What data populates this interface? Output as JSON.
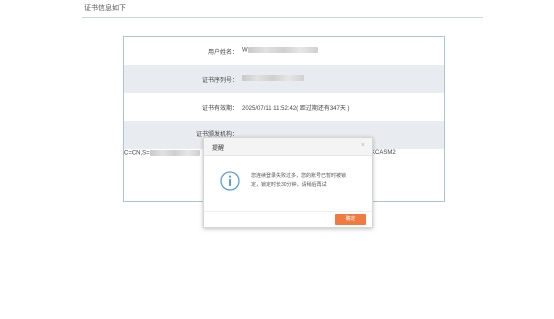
{
  "page": {
    "title": "证书信息如下"
  },
  "cert": {
    "rows": [
      {
        "label": "用户姓名：",
        "value_prefix": "W"
      },
      {
        "label": "证书序列号：",
        "value_prefix": ""
      },
      {
        "label": "证书有效期：",
        "value": "2025/07/11 11:52:42( 距过期还有347天 )"
      },
      {
        "label": "证书颁发机构："
      }
    ],
    "issuer_prefix": "C=CN,S=",
    "issuer_suffix": "KCASM2"
  },
  "dialog": {
    "title": "提醒",
    "close_symbol": "×",
    "message": "您连续登录失败过多，您的账号已暂时被锁定，锁定时长30分钟，请稍后再试",
    "ok_label": "确定",
    "icon": "info-circle-icon"
  },
  "colors": {
    "accent": "#f07a40",
    "icon": "#5aa0d8",
    "panel_border": "#a9c6de",
    "row_alt": "#e8ecf0"
  }
}
